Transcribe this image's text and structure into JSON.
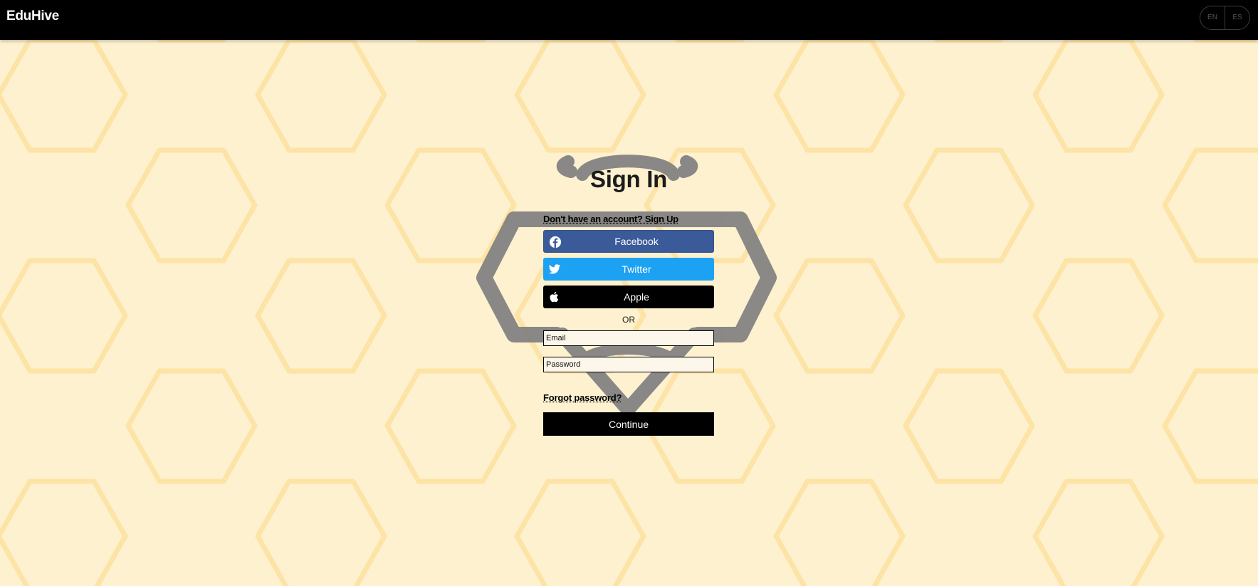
{
  "header": {
    "brand": "EduHive",
    "languages": [
      "EN",
      "ES"
    ]
  },
  "signin": {
    "title": "Sign In",
    "signup_prompt": "Don't have an account? Sign Up",
    "social": {
      "facebook": "Facebook",
      "twitter": "Twitter",
      "apple": "Apple"
    },
    "divider": "OR",
    "email_placeholder": "Email",
    "password_placeholder": "Password",
    "forgot": "Forgot password?",
    "continue": "Continue"
  },
  "colors": {
    "facebook": "#3b5a9a",
    "twitter": "#1da1f2",
    "apple": "#000000",
    "background": "#fdf1cf",
    "honeycomb_line": "#fde4a8"
  },
  "icons": [
    "facebook-icon",
    "twitter-icon",
    "apple-icon",
    "bee-logo"
  ]
}
